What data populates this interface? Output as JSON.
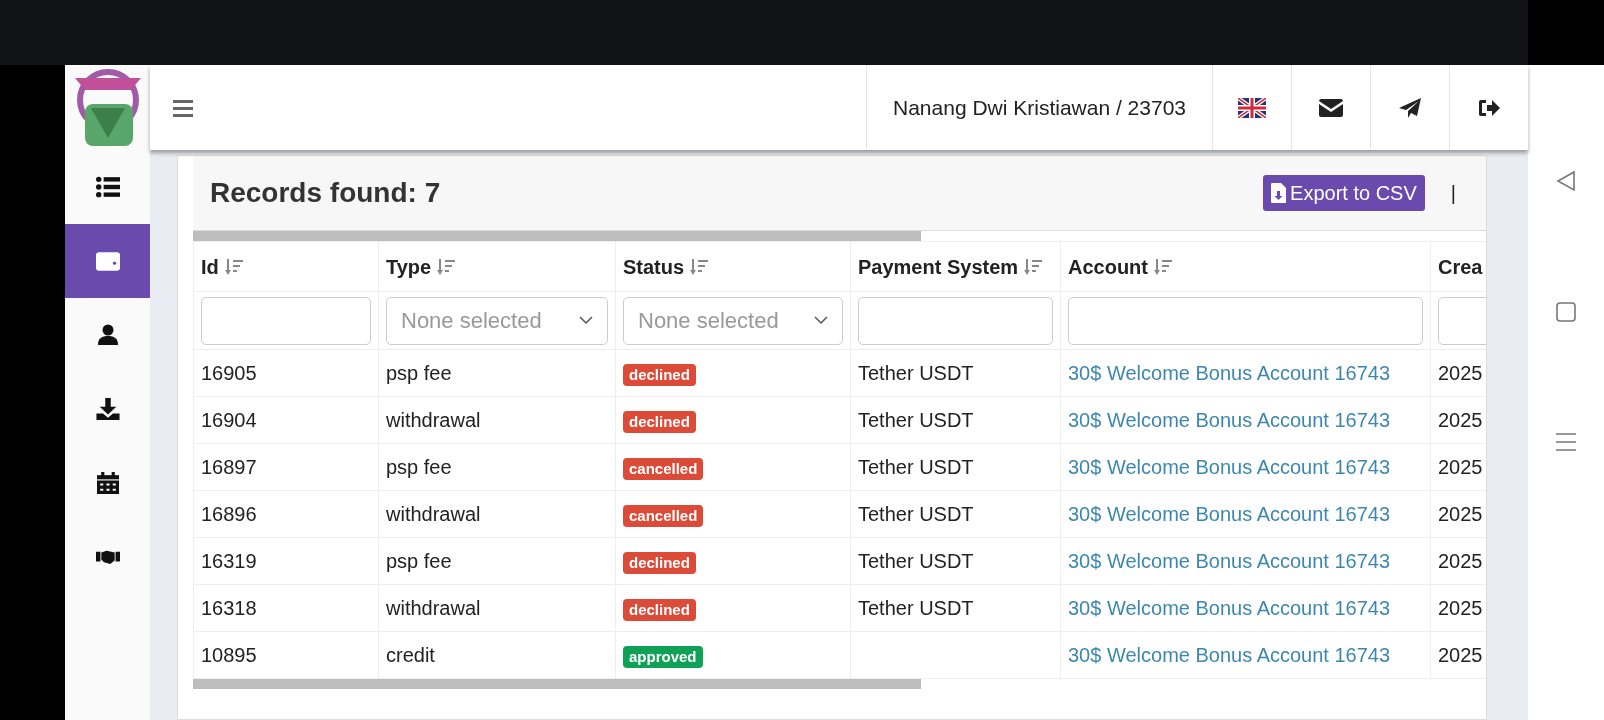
{
  "topbar": {
    "user": "Nanang Dwi Kristiawan / 23703",
    "actions": [
      {
        "kind": "flag"
      },
      {
        "kind": "mail"
      },
      {
        "kind": "send"
      },
      {
        "kind": "logout"
      }
    ]
  },
  "sidebar": {
    "items": [
      {
        "kind": "list",
        "selected": false
      },
      {
        "kind": "wallet",
        "selected": true
      },
      {
        "kind": "user",
        "selected": false
      },
      {
        "kind": "download",
        "selected": false
      },
      {
        "kind": "calendar",
        "selected": false
      },
      {
        "kind": "handshake",
        "selected": false
      }
    ]
  },
  "records": {
    "title": "Records found: 7",
    "export_button": "Export to CSV",
    "separator": "|"
  },
  "table": {
    "columns": [
      {
        "label": "Id",
        "sortable": true
      },
      {
        "label": "Type",
        "sortable": true
      },
      {
        "label": "Status",
        "sortable": true
      },
      {
        "label": "Payment System",
        "sortable": true
      },
      {
        "label": "Account",
        "sortable": true
      },
      {
        "label": "Crea"
      }
    ],
    "filters": [
      {
        "kind": "text"
      },
      {
        "kind": "select",
        "placeholder": "None selected"
      },
      {
        "kind": "select",
        "placeholder": "None selected"
      },
      {
        "kind": "text"
      },
      {
        "kind": "text"
      },
      {
        "kind": "text"
      }
    ],
    "rows": [
      {
        "id": "16905",
        "type": "psp fee",
        "status": {
          "text": "declined",
          "color": "#dc4a38"
        },
        "payment_system": "Tether USDT",
        "account": "30$ Welcome Bonus Account 16743",
        "created": "2025"
      },
      {
        "id": "16904",
        "type": "withdrawal",
        "status": {
          "text": "declined",
          "color": "#dc4a38"
        },
        "payment_system": "Tether USDT",
        "account": "30$ Welcome Bonus Account 16743",
        "created": "2025"
      },
      {
        "id": "16897",
        "type": "psp fee",
        "status": {
          "text": "cancelled",
          "color": "#dc4a38"
        },
        "payment_system": "Tether USDT",
        "account": "30$ Welcome Bonus Account 16743",
        "created": "2025"
      },
      {
        "id": "16896",
        "type": "withdrawal",
        "status": {
          "text": "cancelled",
          "color": "#dc4a38"
        },
        "payment_system": "Tether USDT",
        "account": "30$ Welcome Bonus Account 16743",
        "created": "2025"
      },
      {
        "id": "16319",
        "type": "psp fee",
        "status": {
          "text": "declined",
          "color": "#dc4a38"
        },
        "payment_system": "Tether USDT",
        "account": "30$ Welcome Bonus Account 16743",
        "created": "2025"
      },
      {
        "id": "16318",
        "type": "withdrawal",
        "status": {
          "text": "declined",
          "color": "#dc4a38"
        },
        "payment_system": "Tether USDT",
        "account": "30$ Welcome Bonus Account 16743",
        "created": "2025"
      },
      {
        "id": "10895",
        "type": "credit",
        "status": {
          "text": "approved",
          "color": "#0fa257"
        },
        "account": "30$ Welcome Bonus Account 16743",
        "created": "2025"
      }
    ]
  }
}
